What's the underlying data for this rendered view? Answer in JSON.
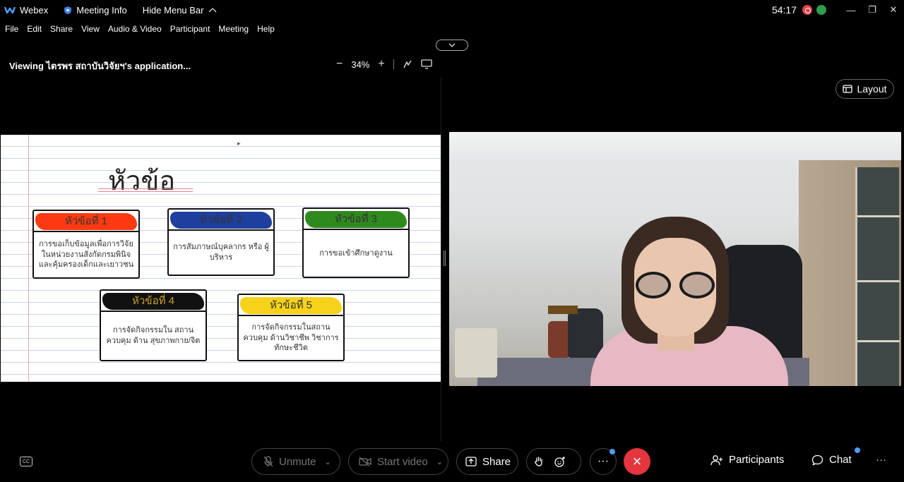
{
  "titlebar": {
    "app_name": "Webex",
    "meeting_info": "Meeting Info",
    "hide_menu": "Hide Menu Bar",
    "timer": "54:17",
    "window_controls": [
      "minimize-icon",
      "restore-icon",
      "close-icon"
    ]
  },
  "menu": {
    "items": [
      "File",
      "Edit",
      "Share",
      "View",
      "Audio & Video",
      "Participant",
      "Meeting",
      "Help"
    ]
  },
  "share": {
    "viewing_label": "Viewing ไตรพร สถาบันวิจัยฯ's application...",
    "zoom": "34%"
  },
  "slide": {
    "title": "หัวข้อ",
    "cards": [
      {
        "heading": "หัวข้อที่ 1",
        "color": "#ff3a12",
        "body": "การขอเก็บข้อมูลเพื่อการวิจัย ในหน่วยงานสังกัดกรมพินิจ และคุ้มครองเด็กและเยาวชน"
      },
      {
        "heading": "หัวข้อที่ 2",
        "color": "#1e3f9e",
        "body": "การสัมภาษณ์บุคลากร หรือ ผู้บริหาร"
      },
      {
        "heading": "หัวข้อที่ 3",
        "color": "#2f8a1e",
        "body": "การขอเข้าศึกษาดูงาน"
      },
      {
        "heading": "หัวข้อที่ 4",
        "color": "#111111",
        "body": "การจัดกิจกรรมใน สถานควบคุม ด้าน สุขภาพกาย/จิต"
      },
      {
        "heading": "หัวข้อที่ 5",
        "color": "#f6d21b",
        "body": "การจัดกิจกรรมในสถาน ควบคุม ด้านวิชาชีพ วิชาการ ทักษะชีวิต"
      }
    ]
  },
  "layout_button": {
    "label": "Layout"
  },
  "controls": {
    "unmute": "Unmute",
    "start_video": "Start video",
    "share": "Share",
    "participants": "Participants",
    "chat": "Chat"
  },
  "colors": {
    "leave": "#e5353d",
    "notify_dot": "#4d9ff5",
    "recording": "#e0444b"
  }
}
